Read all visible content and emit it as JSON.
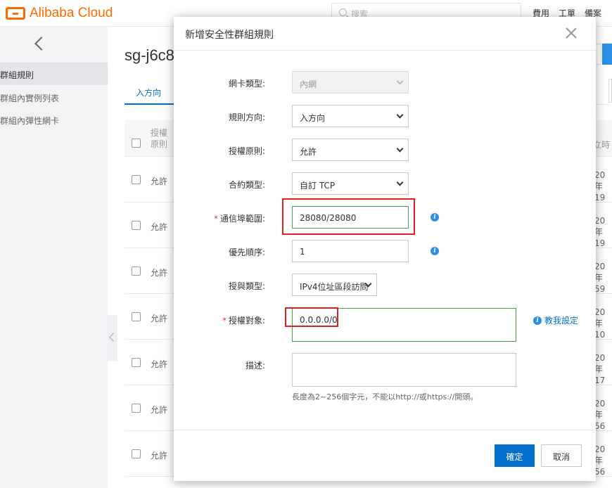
{
  "topbar": {
    "brand": "Alibaba Cloud",
    "search_placeholder": "搜索",
    "links": [
      "費用",
      "工單",
      "備案"
    ]
  },
  "sidebar": {
    "items": [
      {
        "label": "群組規則",
        "active": true
      },
      {
        "label": "群組內實例列表",
        "active": false
      },
      {
        "label": "群組內彈性網卡",
        "active": false
      }
    ]
  },
  "main": {
    "title": "sg-j6c8",
    "tab_inbound": "入方向",
    "table": {
      "header_auth": "授權原則",
      "header_time": "立時",
      "rows": [
        {
          "policy": "允許",
          "date1": "20年",
          "date2": "19"
        },
        {
          "policy": "允許",
          "date1": "20年",
          "date2": "19"
        },
        {
          "policy": "允許",
          "date1": "20年",
          "date2": "59"
        },
        {
          "policy": "允許",
          "date1": "20年",
          "date2": "10"
        },
        {
          "policy": "允許",
          "date1": "20年",
          "date2": "17"
        },
        {
          "policy": "允許",
          "date1": "20年",
          "date2": "56"
        },
        {
          "policy": "允許",
          "date1": "20年",
          "date2": "56"
        }
      ]
    }
  },
  "modal": {
    "title": "新增安全性群組規則",
    "fields": {
      "nic_type": {
        "label": "網卡類型:",
        "value": "內網"
      },
      "direction": {
        "label": "規則方向:",
        "value": "入方向"
      },
      "policy": {
        "label": "授權原則:",
        "value": "允許"
      },
      "protocol": {
        "label": "合約類型:",
        "value": "自訂 TCP"
      },
      "port_range": {
        "label": "通信埠範圍:",
        "value": "28080/28080",
        "required": "*"
      },
      "priority": {
        "label": "優先順序:",
        "value": "1"
      },
      "auth_type": {
        "label": "授與類型:",
        "value": "IPv4位址區段訪問"
      },
      "auth_object": {
        "label": "授權對象:",
        "value": "0.0.0.0/0",
        "required": "*"
      },
      "description": {
        "label": "描述:",
        "value": ""
      }
    },
    "help_link": "教我設定",
    "info_glyph": "i",
    "hint": "長度為2~256個字元，不能以http://或https://開頭。",
    "ok_label": "確定",
    "cancel_label": "取消"
  },
  "colors": {
    "brand_orange": "#ff6a00",
    "primary_blue": "#0070cc",
    "highlight_red": "#e02020",
    "valid_green": "#3aa63a"
  }
}
